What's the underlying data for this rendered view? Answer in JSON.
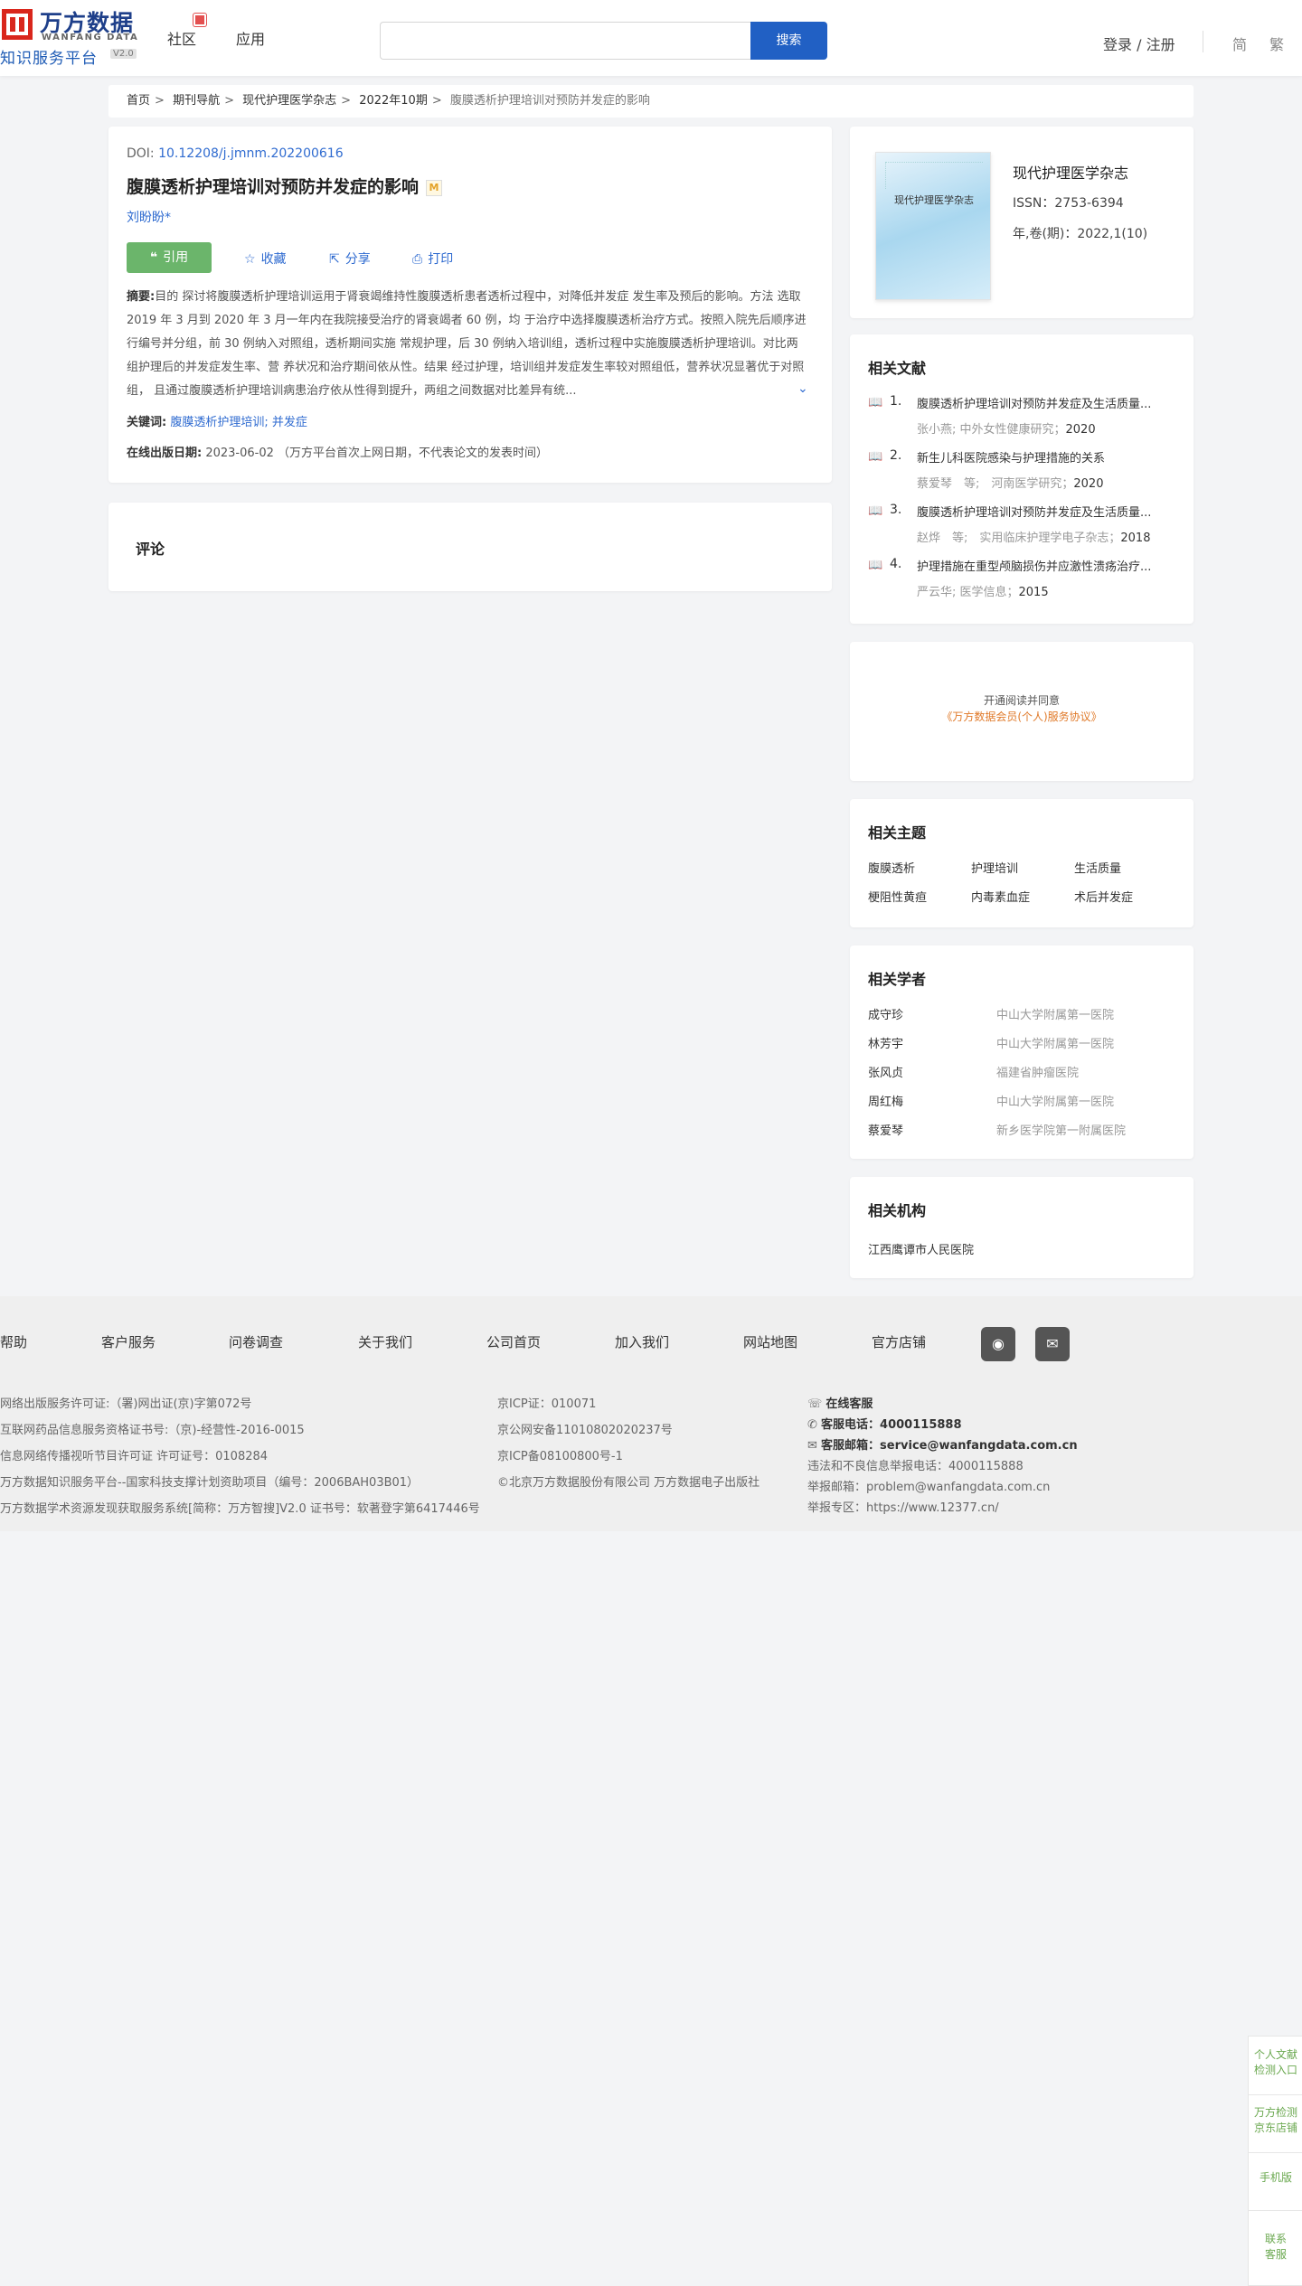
{
  "header": {
    "logo_cn": "万方数据",
    "logo_en": "WANFANG DATA",
    "logo_sub": "知识服务平台",
    "logo_ver": "V2.0",
    "nav": [
      "社区",
      "应用"
    ],
    "search_placeholder": "",
    "search_button": "搜索",
    "login": "登录 / 注册",
    "lang_simplified": "简",
    "lang_traditional": "繁"
  },
  "breadcrumb": {
    "items": [
      "首页",
      "期刊导航",
      "现代护理医学杂志",
      "2022年10期"
    ],
    "current": "腹膜透析护理培训对预防并发症的影响",
    "separator": ">"
  },
  "article": {
    "doi_label": "DOI: ",
    "doi_value": "10.12208/j.jmnm.202200616",
    "title": "腹膜透析护理培训对预防并发症的影响",
    "badge": "M",
    "author": "刘盼盼*",
    "actions": {
      "cite": "引用",
      "favorite": "收藏",
      "share": "分享",
      "print": "打印"
    },
    "abstract_label": "摘要:",
    "abstract_text": "目的 探讨将腹膜透析护理培训运用于肾衰竭维持性腹膜透析患者透析过程中，对降低并发症 发生率及预后的影响。方法 选取 2019 年 3 月到 2020 年 3 月一年内在我院接受治疗的肾衰竭者 60 例，均 于治疗中选择腹膜透析治疗方式。按照入院先后顺序进行编号并分组，前 30 例纳入对照组，透析期间实施 常规护理，后 30 例纳入培训组，透析过程中实施腹膜透析护理培训。对比两组护理后的并发症发生率、营 养状况和治疗期间依从性。结果 经过护理，培训组并发症发生率较对照组低，营养状况显著优于对照组， 且通过腹膜透析护理培训病患治疗依从性得到提升，两组之间数据对比差异有统...",
    "keywords_label": "关键词:",
    "keywords": [
      "腹膜透析护理培训",
      "并发症"
    ],
    "keywords_sep": "; ",
    "pub_label": "在线出版日期:",
    "pub_value": "2023-06-02 （万方平台首次上网日期，不代表论文的发表时间）"
  },
  "comments": {
    "title": "评论"
  },
  "journal": {
    "cover_title": "现代护理医学杂志",
    "name": "现代护理医学杂志",
    "issn": "ISSN：2753-6394",
    "year_issue": "年,卷(期)：2022,1(10)"
  },
  "related": {
    "title": "相关文献",
    "items": [
      {
        "num": "1.",
        "title": "腹膜透析护理培训对预防并发症及生活质量...",
        "meta": "张小燕; 中外女性健康研究；",
        "year": "2020"
      },
      {
        "num": "2.",
        "title": "新生儿科医院感染与护理措施的关系",
        "meta": "蔡爱琴　等;　河南医学研究；",
        "year": "2020"
      },
      {
        "num": "3.",
        "title": "腹膜透析护理培训对预防并发症及生活质量...",
        "meta": "赵烨　等;　实用临床护理学电子杂志；",
        "year": "2018"
      },
      {
        "num": "4.",
        "title": "护理措施在重型颅脑损伤并应激性溃疡治疗...",
        "meta": "严云华; 医学信息；",
        "year": "2015"
      }
    ]
  },
  "open_access": {
    "line1": "开通阅读并同意",
    "line2": "《万方数据会员(个人)服务协议》"
  },
  "topics": {
    "title": "相关主题",
    "items": [
      "腹膜透析",
      "护理培训",
      "生活质量",
      "梗阻性黄疸",
      "内毒素血症",
      "术后并发症"
    ]
  },
  "scholars": {
    "title": "相关学者",
    "items": [
      {
        "name": "成守珍",
        "org": "中山大学附属第一医院"
      },
      {
        "name": "林芳宇",
        "org": "中山大学附属第一医院"
      },
      {
        "name": "张风贞",
        "org": "福建省肿瘤医院"
      },
      {
        "name": "周红梅",
        "org": "中山大学附属第一医院"
      },
      {
        "name": "蔡爱琴",
        "org": "新乡医学院第一附属医院"
      }
    ]
  },
  "institutions": {
    "title": "相关机构",
    "items": [
      "江西鹰谭市人民医院"
    ]
  },
  "footer": {
    "links": [
      "帮助",
      "客户服务",
      "问卷调查",
      "关于我们",
      "公司首页",
      "加入我们",
      "网站地图",
      "官方店铺"
    ],
    "social": [
      "weibo-icon",
      "wechat-icon"
    ],
    "left": [
      "网络出版服务许可证:（署)网出证(京)字第072号",
      "互联网药品信息服务资格证书号:（京)-经营性-2016-0015",
      "信息网络传播视听节目许可证 许可证号：0108284",
      "万方数据知识服务平台--国家科技支撑计划资助项目（编号：2006BAH03B01）",
      "万方数据学术资源发现获取服务系统[简称：万方智搜]V2.0 证书号：软著登字第6417446号"
    ],
    "middle": [
      "京ICP证：010071",
      "京公网安备11010802020237号",
      "京ICP备08100800号-1",
      "©北京万方数据股份有限公司 万方数据电子出版社"
    ],
    "right": {
      "online_service": "在线客服",
      "phone_label": "客服电话：",
      "phone": "4000115888",
      "email_label": "客服邮箱：",
      "email": "service@wanfangdata.com.cn",
      "report_phone": "违法和不良信息举报电话：4000115888",
      "report_email": "举报邮箱：problem@wanfangdata.com.cn",
      "report_zone": "举报专区：https://www.12377.cn/"
    }
  },
  "side_float": [
    [
      "个人文献",
      "检测入口"
    ],
    [
      "万方检测",
      "京东店铺"
    ],
    [
      "手机版"
    ],
    [
      "联系",
      "客服"
    ]
  ]
}
